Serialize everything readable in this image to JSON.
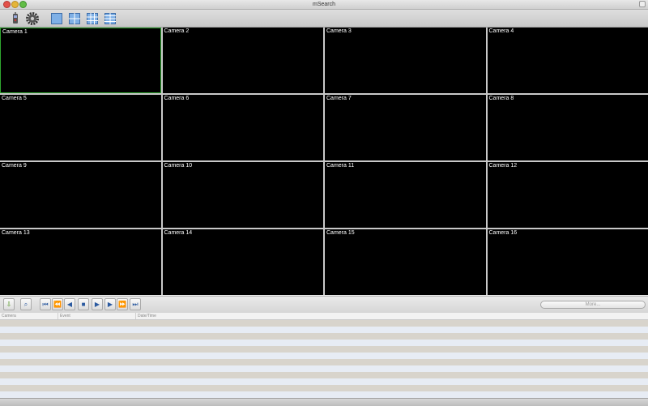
{
  "window": {
    "title": "mSearch"
  },
  "toolbar": {
    "buttons": [
      {
        "name": "remote-icon"
      },
      {
        "name": "gear-icon"
      },
      {
        "name": "layout-1x1-icon"
      },
      {
        "name": "layout-2x2-icon"
      },
      {
        "name": "layout-3x3-icon"
      },
      {
        "name": "layout-4x4-icon"
      }
    ]
  },
  "grid": {
    "selected": 0,
    "selected_color": "#2ea52e",
    "cameras": [
      "Camera 1",
      "Camera 2",
      "Camera 3",
      "Camera 4",
      "Camera 5",
      "Camera 6",
      "Camera 7",
      "Camera 8",
      "Camera 9",
      "Camera 10",
      "Camera 11",
      "Camera 12",
      "Camera 13",
      "Camera 14",
      "Camera 15",
      "Camera 16"
    ]
  },
  "playback": {
    "more_label": "More...",
    "buttons": [
      {
        "name": "download-icon",
        "glyph": "⇩"
      },
      {
        "name": "search-icon",
        "glyph": "⌕"
      },
      {
        "name": "skip-to-start-icon",
        "glyph": "⏮"
      },
      {
        "name": "fast-rewind-icon",
        "glyph": "⏪"
      },
      {
        "name": "step-back-icon",
        "glyph": "◀"
      },
      {
        "name": "stop-icon",
        "glyph": "■"
      },
      {
        "name": "play-icon",
        "glyph": "▶"
      },
      {
        "name": "step-forward-icon",
        "glyph": "▶"
      },
      {
        "name": "fast-forward-icon",
        "glyph": "⏩"
      },
      {
        "name": "skip-to-end-icon",
        "glyph": "⏭"
      }
    ]
  },
  "events_table": {
    "columns": [
      "Camera",
      "Event",
      "Date/Time"
    ],
    "rows": []
  }
}
